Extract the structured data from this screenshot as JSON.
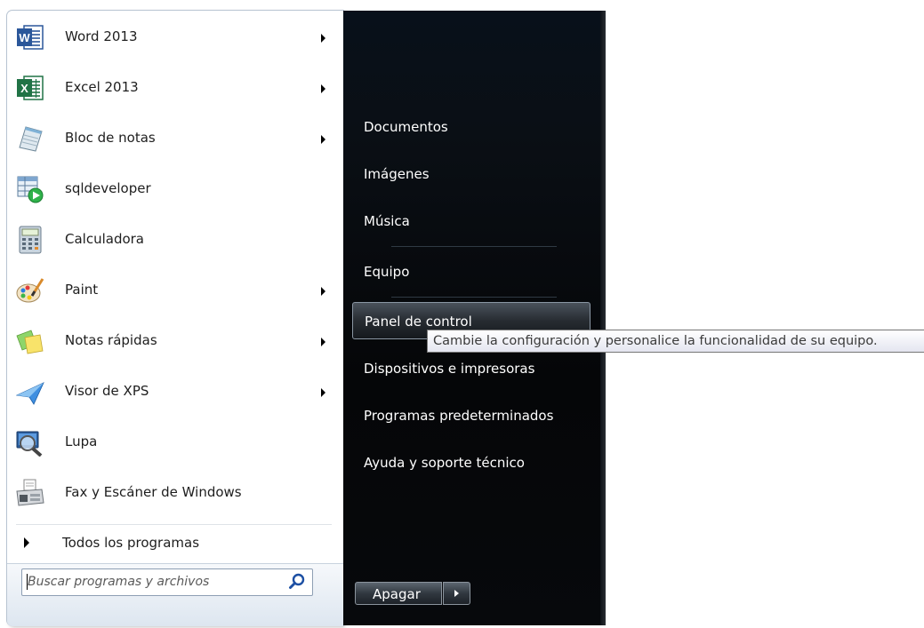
{
  "start_menu": {
    "programs": [
      {
        "label": "Word 2013",
        "icon": "word-icon",
        "has_submenu": true
      },
      {
        "label": "Excel 2013",
        "icon": "excel-icon",
        "has_submenu": true
      },
      {
        "label": "Bloc de notas",
        "icon": "notepad-icon",
        "has_submenu": true
      },
      {
        "label": "sqldeveloper",
        "icon": "sqldeveloper-icon",
        "has_submenu": false
      },
      {
        "label": "Calculadora",
        "icon": "calculator-icon",
        "has_submenu": false
      },
      {
        "label": "Paint",
        "icon": "paint-icon",
        "has_submenu": true
      },
      {
        "label": "Notas rápidas",
        "icon": "sticky-notes-icon",
        "has_submenu": true
      },
      {
        "label": "Visor de XPS",
        "icon": "xps-viewer-icon",
        "has_submenu": true
      },
      {
        "label": "Lupa",
        "icon": "magnifier-icon",
        "has_submenu": false
      },
      {
        "label": "Fax y Escáner de Windows",
        "icon": "fax-scanner-icon",
        "has_submenu": false
      }
    ],
    "all_programs_label": "Todos los programas",
    "search": {
      "placeholder": "Buscar programas y archivos",
      "value": ""
    },
    "right_items": [
      {
        "label": "Documentos"
      },
      {
        "label": "Imágenes"
      },
      {
        "label": "Música"
      },
      {
        "label": "Equipo"
      },
      {
        "label": "Panel de control",
        "hovered": true
      },
      {
        "label": "Dispositivos e impresoras"
      },
      {
        "label": "Programas predeterminados"
      },
      {
        "label": "Ayuda y soporte técnico"
      }
    ],
    "shutdown_label": "Apagar",
    "tooltip": "Cambie la configuración y personalice la funcionalidad de su equipo."
  },
  "colors": {
    "word_blue": "#2b579a",
    "excel_green": "#217346",
    "right_panel_bg": "#07090c",
    "search_icon": "#1c4fa3"
  }
}
